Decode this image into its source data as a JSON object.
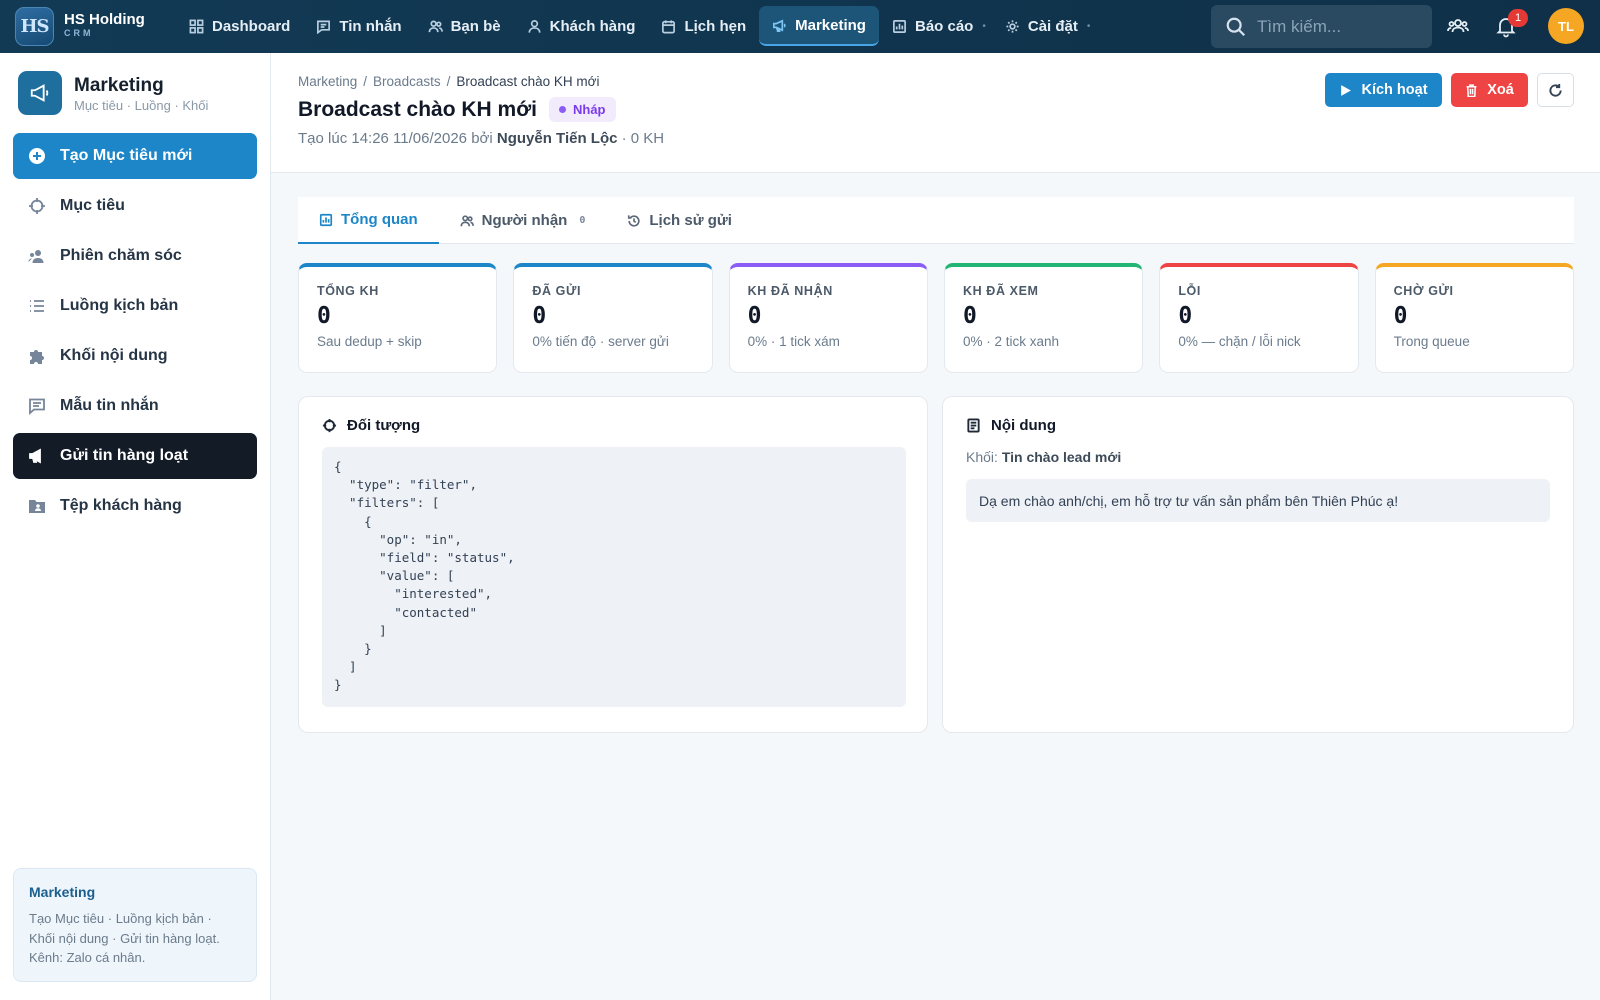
{
  "brand": {
    "logo_text": "HS",
    "name": "HS Holding",
    "sub": "CRM"
  },
  "nav": {
    "items": [
      {
        "label": "Dashboard",
        "icon": "grid-icon"
      },
      {
        "label": "Tin nhắn",
        "icon": "message-icon"
      },
      {
        "label": "Bạn bè",
        "icon": "users-icon"
      },
      {
        "label": "Khách hàng",
        "icon": "user-icon"
      },
      {
        "label": "Lịch hẹn",
        "icon": "calendar-icon"
      },
      {
        "label": "Marketing",
        "icon": "megaphone-icon",
        "active": true
      },
      {
        "label": "Báo cáo",
        "icon": "chart-icon"
      },
      {
        "label": "Cài đặt",
        "icon": "gear-icon"
      }
    ],
    "search_placeholder": "Tìm kiếm...",
    "notification_count": "1",
    "avatar_initials": "TL"
  },
  "sidebar": {
    "title": "Marketing",
    "subtitle": "Mục tiêu · Luồng · Khối",
    "items": [
      {
        "label": "Tạo Mục tiêu mới",
        "icon": "plus-circle-icon"
      },
      {
        "label": "Mục tiêu",
        "icon": "crosshair-icon"
      },
      {
        "label": "Phiên chăm sóc",
        "icon": "user-group-icon"
      },
      {
        "label": "Luồng kịch bản",
        "icon": "list-icon"
      },
      {
        "label": "Khối nội dung",
        "icon": "puzzle-icon"
      },
      {
        "label": "Mẫu tin nhắn",
        "icon": "message-icon"
      },
      {
        "label": "Gửi tin hàng loạt",
        "icon": "megaphone-icon"
      },
      {
        "label": "Tệp khách hàng",
        "icon": "folder-user-icon"
      }
    ],
    "note": {
      "title": "Marketing",
      "body": "Tạo Mục tiêu · Luồng kịch bản · Khối nội dung · Gửi tin hàng loạt. Kênh: Zalo cá nhân."
    }
  },
  "header": {
    "breadcrumb": [
      "Marketing",
      "Broadcasts",
      "Broadcast chào KH mới"
    ],
    "title": "Broadcast chào KH mới",
    "status": "Nháp",
    "meta_prefix": "Tạo lúc 14:26 11/06/2026 bởi",
    "meta_author": "Nguyễn Tiến Lộc",
    "meta_suffix": "· 0 KH",
    "activate_label": "Kích hoạt",
    "delete_label": "Xoá"
  },
  "tabs": [
    {
      "label": "Tổng quan",
      "icon": "chart-icon",
      "count": ""
    },
    {
      "label": "Người nhận",
      "icon": "users-icon",
      "count": "0"
    },
    {
      "label": "Lịch sử gửi",
      "icon": "history-icon",
      "count": ""
    }
  ],
  "stats": [
    {
      "label": "TỔNG KH",
      "value": "0",
      "desc": "Sau dedup + skip",
      "color": "#1d86c8"
    },
    {
      "label": "ĐÃ GỬI",
      "value": "0",
      "desc": "0% tiến độ · server gửi",
      "color": "#1d86c8"
    },
    {
      "label": "KH ĐÃ NHẬN",
      "value": "0",
      "desc": "0% · 1 tick xám",
      "color": "#8b5cf6"
    },
    {
      "label": "KH ĐÃ XEM",
      "value": "0",
      "desc": "0% · 2 tick xanh",
      "color": "#22b573"
    },
    {
      "label": "LỖI",
      "value": "0",
      "desc": "0% — chặn / lỗi nick",
      "color": "#ef4444"
    },
    {
      "label": "CHỜ GỬI",
      "value": "0",
      "desc": "Trong queue",
      "color": "#f5a623"
    }
  ],
  "audience": {
    "title": "Đối tượng",
    "code": "{\n  \"type\": \"filter\",\n  \"filters\": [\n    {\n      \"op\": \"in\",\n      \"field\": \"status\",\n      \"value\": [\n        \"interested\",\n        \"contacted\"\n      ]\n    }\n  ]\n}"
  },
  "content": {
    "title": "Nội dung",
    "block_label": "Khối:",
    "block_name": "Tin chào lead mới",
    "message": "Dạ em chào anh/chị, em hỗ trợ tư vấn sản phẩm bên Thiên Phúc ạ!"
  }
}
